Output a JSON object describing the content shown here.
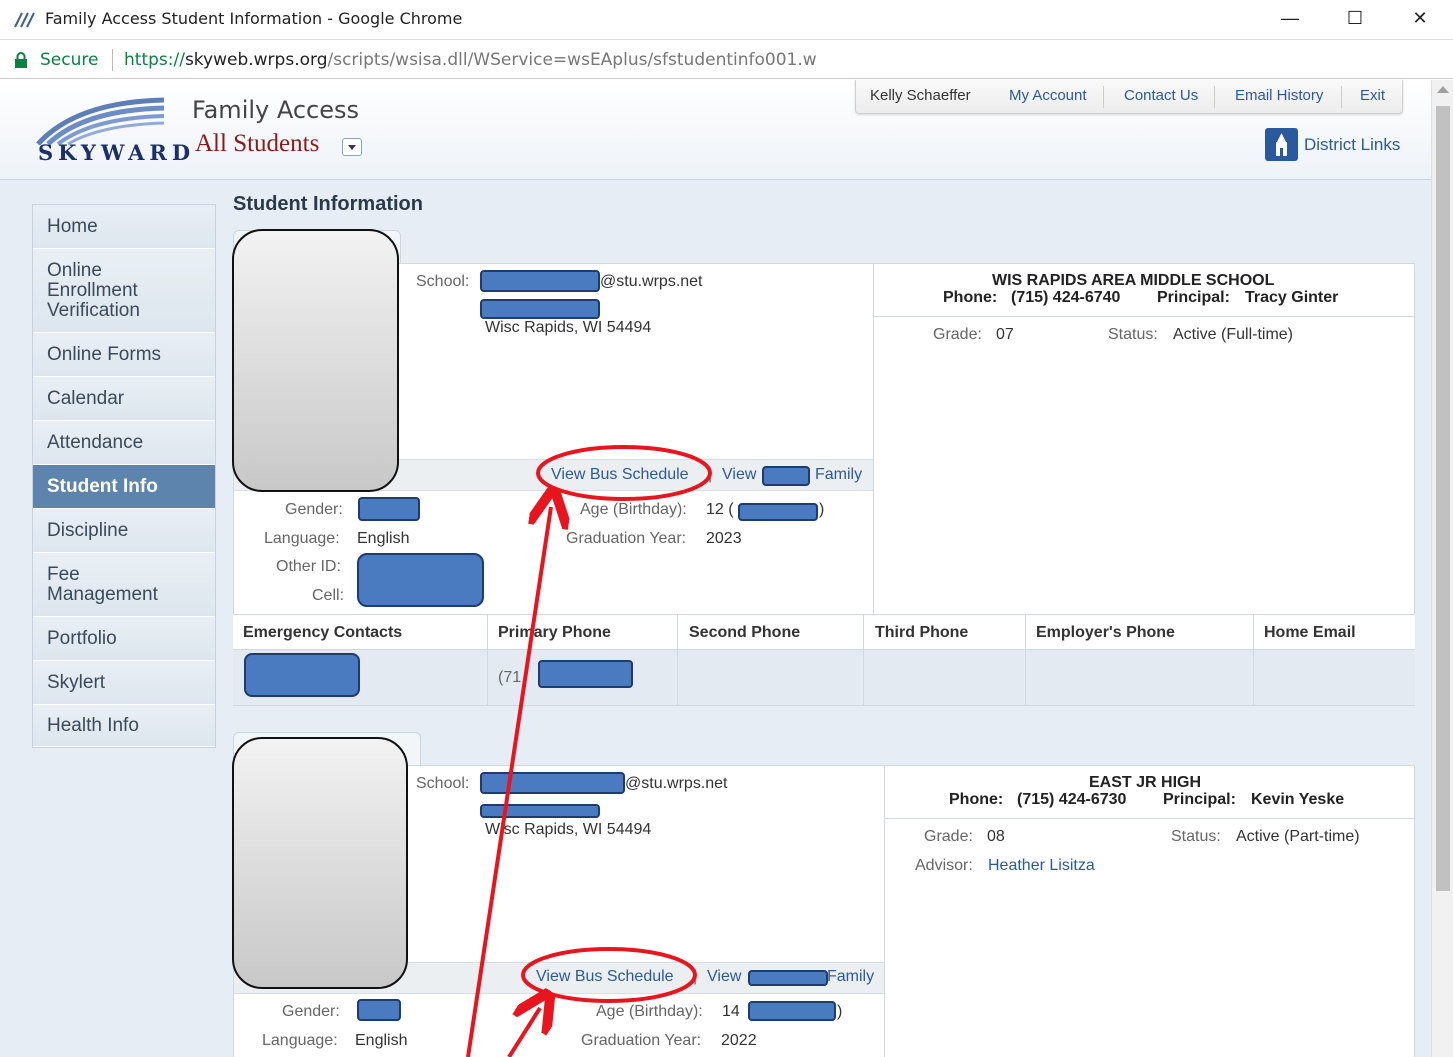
{
  "browser": {
    "window_title": "Family Access Student Information - Google Chrome",
    "secure_label": "Secure",
    "url_scheme": "https://",
    "url_host": "skyweb.wrps.org",
    "url_path": "/scripts/wsisa.dll/WService=wsEAplus/sfstudentinfo001.w",
    "minimize": "—",
    "maximize": "☐",
    "close": "✕"
  },
  "header": {
    "logo_text": "SKYWARD",
    "app_title": "Family Access",
    "student_selector": "All Students",
    "user_name": "Kelly Schaeffer",
    "links": [
      "My Account",
      "Contact Us",
      "Email History",
      "Exit"
    ],
    "district_links": "District Links"
  },
  "sidebar": {
    "items": [
      {
        "label": "Home"
      },
      {
        "label": "Online Enrollment Verification"
      },
      {
        "label": "Online Forms"
      },
      {
        "label": "Calendar"
      },
      {
        "label": "Attendance"
      },
      {
        "label": "Student Info",
        "active": true
      },
      {
        "label": "Discipline"
      },
      {
        "label": "Fee Management"
      },
      {
        "label": "Portfolio"
      },
      {
        "label": "Skylert"
      },
      {
        "label": "Health Info"
      }
    ]
  },
  "main": {
    "section_title": "Student Information",
    "students": [
      {
        "school_label": "School:",
        "email_suffix": "@stu.wrps.net",
        "city_line": "Wisc Rapids, WI 54494",
        "view_bus": "View Bus Schedule",
        "view_word": "View",
        "family_word": "Family",
        "gender_label": "Gender:",
        "language_label": "Language:",
        "language_value": "English",
        "other_id_label": "Other ID:",
        "cell_label": "Cell:",
        "age_label": "Age (Birthday):",
        "age_value": "12 (",
        "age_close": ")",
        "grad_label": "Graduation Year:",
        "grad_value": "2023",
        "school_name": "WIS RAPIDS AREA MIDDLE SCHOOL",
        "phone_label": "Phone:",
        "phone_value": "(715) 424-6740",
        "principal_label": "Principal:",
        "principal_value": "Tracy Ginter",
        "grade_label": "Grade:",
        "grade_value": "07",
        "status_label": "Status:",
        "status_value": "Active (Full-time)",
        "contacts": {
          "headers": [
            "Emergency Contacts",
            "Primary Phone",
            "Second Phone",
            "Third Phone",
            "Employer's Phone",
            "Home Email"
          ],
          "primary_phone_prefix": "(71"
        }
      },
      {
        "school_label": "School:",
        "email_suffix": "@stu.wrps.net",
        "city_line": "Wisc Rapids, WI 54494",
        "view_bus": "View Bus Schedule",
        "view_word": "View",
        "family_word": "Family",
        "gender_label": "Gender:",
        "language_label": "Language:",
        "language_value": "English",
        "age_label": "Age (Birthday):",
        "age_value": "14",
        "age_close": ")",
        "grad_label": "Graduation Year:",
        "grad_value": "2022",
        "school_name": "EAST JR HIGH",
        "phone_label": "Phone:",
        "phone_value": "(715) 424-6730",
        "principal_label": "Principal:",
        "principal_value": "Kevin Yeske",
        "grade_label": "Grade:",
        "grade_value": "08",
        "status_label": "Status:",
        "status_value": "Active (Part-time)",
        "advisor_label": "Advisor:",
        "advisor_value": "Heather Lisitza"
      }
    ]
  },
  "colors": {
    "annotation_red": "#e8141e",
    "link_blue": "#2b5a9c",
    "redaction_blue": "#4a7ac0",
    "sidebar_active": "#5d84ac"
  }
}
